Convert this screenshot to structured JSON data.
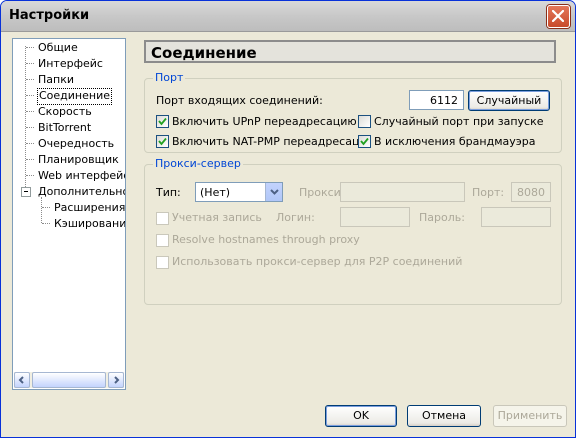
{
  "window": {
    "title": "Настройки"
  },
  "sidebar": {
    "items": [
      {
        "label": "Общие"
      },
      {
        "label": "Интерфейс"
      },
      {
        "label": "Папки"
      },
      {
        "label": "Соединение"
      },
      {
        "label": "Скорость"
      },
      {
        "label": "BitTorrent"
      },
      {
        "label": "Очередность"
      },
      {
        "label": "Планировщик"
      },
      {
        "label": "Web интерфейс"
      },
      {
        "label": "Дополнительно"
      },
      {
        "label": "Расширения и"
      },
      {
        "label": "Кэширование"
      }
    ],
    "selected": "Соединение"
  },
  "page": {
    "title": "Соединение"
  },
  "port": {
    "legend": "Порт",
    "incoming_label": "Порт входящих соединений:",
    "incoming_value": "6112",
    "random_button": "Случайный",
    "upnp_label": "Включить UPnP переадресацию",
    "upnp_checked": true,
    "random_on_start_label": "Случайный порт при запуске",
    "random_on_start_checked": false,
    "natpmp_label": "Включить NAT-PMP переадресаци",
    "natpmp_checked": true,
    "firewall_label": "В исключения брандмауэра",
    "firewall_checked": true
  },
  "proxy": {
    "legend": "Прокси-сервер",
    "type_label": "Тип:",
    "type_value": "(Нет)",
    "proxy_label": "Прокси:",
    "proxy_value": "",
    "port_label": "Порт:",
    "port_value": "8080",
    "account_label": "Учетная запись",
    "login_label": "Логин:",
    "login_value": "",
    "password_label": "Пароль:",
    "password_value": "",
    "resolve_label": "Resolve hostnames through proxy",
    "p2p_label": "Использовать прокси-сервер для P2P соединений"
  },
  "buttons": {
    "ok": "OK",
    "cancel": "Отмена",
    "apply": "Применить"
  }
}
